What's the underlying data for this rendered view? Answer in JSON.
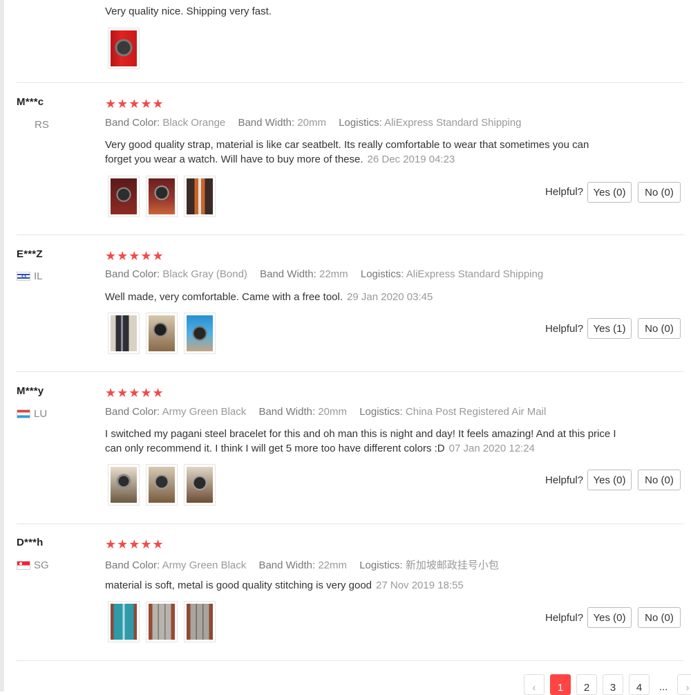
{
  "reviews": [
    {
      "text": "Very quality nice. Shipping very fast.",
      "images": [
        "watch-red-box"
      ]
    },
    {
      "user": "M***c",
      "country": "RS",
      "stars": "★★★★★",
      "sku": [
        {
          "label": "Band Color:",
          "value": "Black Orange"
        },
        {
          "label": "Band Width:",
          "value": "20mm"
        },
        {
          "label": "Logistics:",
          "value": "AliExpress Standard Shipping"
        }
      ],
      "text": "Very good quality strap, material is like car seatbelt. Its really comfortable to wear that sometimes you can forget you wear a watch. Will have to buy more of these.",
      "date": "26 Dec 2019 04:23",
      "helpful_label": "Helpful?",
      "yes": "Yes (0)",
      "no": "No (0)"
    },
    {
      "user": "E***Z",
      "country": "IL",
      "stars": "★★★★★",
      "sku": [
        {
          "label": "Band Color:",
          "value": "Black Gray (Bond)"
        },
        {
          "label": "Band Width:",
          "value": "22mm"
        },
        {
          "label": "Logistics:",
          "value": "AliExpress Standard Shipping"
        }
      ],
      "text": "Well made, very comfortable. Came with a free tool.",
      "date": "29 Jan 2020 03:45",
      "helpful_label": "Helpful?",
      "yes": "Yes (1)",
      "no": "No (0)"
    },
    {
      "user": "M***y",
      "country": "LU",
      "stars": "★★★★★",
      "sku": [
        {
          "label": "Band Color:",
          "value": "Army Green Black"
        },
        {
          "label": "Band Width:",
          "value": "20mm"
        },
        {
          "label": "Logistics:",
          "value": "China Post Registered Air Mail"
        }
      ],
      "text": "I switched my pagani steel bracelet for this and oh man this is night and day! It feels amazing! And at this price I can only recommend it. I think I will get 5 more too have different colors :D",
      "date": "07 Jan 2020 12:24",
      "helpful_label": "Helpful?",
      "yes": "Yes (0)",
      "no": "No (0)"
    },
    {
      "user": "D***h",
      "country": "SG",
      "stars": "★★★★★",
      "sku": [
        {
          "label": "Band Color:",
          "value": "Army Green Black"
        },
        {
          "label": "Band Width:",
          "value": "22mm"
        },
        {
          "label": "Logistics:",
          "value": "新加坡邮政挂号小包"
        }
      ],
      "text": "material is soft, metal is good quality stitching is very good",
      "date": "27 Nov 2019 18:55",
      "helpful_label": "Helpful?",
      "yes": "Yes (0)",
      "no": "No (0)"
    }
  ],
  "pagination": {
    "prev": "‹",
    "pages": [
      "1",
      "2",
      "3",
      "4"
    ],
    "ellipsis": "...",
    "next": "›",
    "active_page": "1"
  },
  "colors": {
    "star": "#f14b4b",
    "active_page": "#ff4444"
  }
}
